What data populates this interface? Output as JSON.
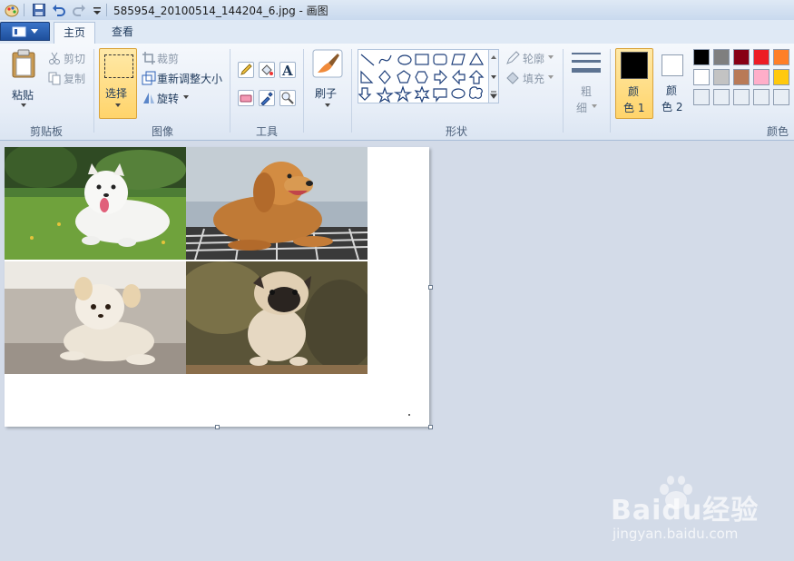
{
  "window": {
    "title": "585954_20100514_144204_6.jpg - 画图"
  },
  "tabs": [
    {
      "label": "主页",
      "active": true
    },
    {
      "label": "查看",
      "active": false
    }
  ],
  "clipboard": {
    "paste": "粘贴",
    "cut": "剪切",
    "copy": "复制",
    "group": "剪贴板"
  },
  "image": {
    "select": "选择",
    "crop": "裁剪",
    "resize": "重新调整大小",
    "rotate": "旋转",
    "group": "图像"
  },
  "tools": {
    "group": "工具"
  },
  "brush": {
    "label": "刷子"
  },
  "shapes": {
    "outline": "轮廓",
    "fill": "填充",
    "group": "形状"
  },
  "size": {
    "label_line1": "粗",
    "label_line2": "细"
  },
  "colors": {
    "color1_line1": "颜",
    "color1_line2": "色 1",
    "color2_line1": "颜",
    "color2_line2": "色 2",
    "group": "颜色",
    "color1": "#000000",
    "color2": "#ffffff",
    "palette": [
      "#000000",
      "#7f7f7f",
      "#880015",
      "#ed1c24",
      "#ff7f27",
      "#ffffff",
      "#c3c3c3",
      "#b97a57",
      "#ffaec9",
      "#ffc90e",
      "#e8eef5",
      "#e8eef5",
      "#e8eef5",
      "#e8eef5",
      "#e8eef5"
    ]
  },
  "watermark": {
    "brand": "Baidu经验",
    "url": "jingyan.baidu.com"
  }
}
